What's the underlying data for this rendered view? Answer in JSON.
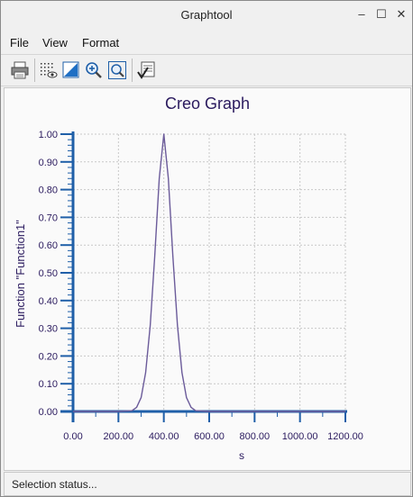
{
  "window": {
    "title": "Graphtool",
    "controls": {
      "minimize": "–",
      "maximize": "☐",
      "close": "✕"
    }
  },
  "menu": {
    "items": [
      {
        "label": "File"
      },
      {
        "label": "View"
      },
      {
        "label": "Format"
      }
    ]
  },
  "toolbar": {
    "icons": [
      "print-icon",
      "grid-toggle-icon",
      "background-color-icon",
      "zoom-in-icon",
      "zoom-fit-icon",
      "spreadsheet-check-icon"
    ]
  },
  "status": {
    "text": "Selection status..."
  },
  "colors": {
    "axis": "#1f5fa8",
    "curve": "#6b5b9a",
    "grid": "#c8c8c8",
    "text": "#2a1a5e"
  },
  "chart_data": {
    "type": "line",
    "title": "Creo Graph",
    "xlabel": "s",
    "ylabel": "Function \"Function1\"",
    "xlim": [
      0,
      1200
    ],
    "ylim": [
      0,
      1
    ],
    "xticks": [
      "0.00",
      "200.00",
      "400.00",
      "600.00",
      "800.00",
      "1000.00",
      "1200.00"
    ],
    "yticks": [
      "0.00",
      "0.10",
      "0.20",
      "0.30",
      "0.40",
      "0.50",
      "0.60",
      "0.70",
      "0.80",
      "0.90",
      "1.00"
    ],
    "grid": true,
    "series": [
      {
        "x": [
          0,
          200,
          260,
          280,
          300,
          320,
          340,
          360,
          380,
          400,
          420,
          440,
          460,
          480,
          500,
          520,
          540,
          600,
          1200
        ],
        "values": [
          0,
          0,
          0.003,
          0.015,
          0.05,
          0.14,
          0.31,
          0.56,
          0.84,
          1.0,
          0.84,
          0.56,
          0.31,
          0.14,
          0.05,
          0.015,
          0.003,
          0,
          0
        ]
      }
    ]
  }
}
